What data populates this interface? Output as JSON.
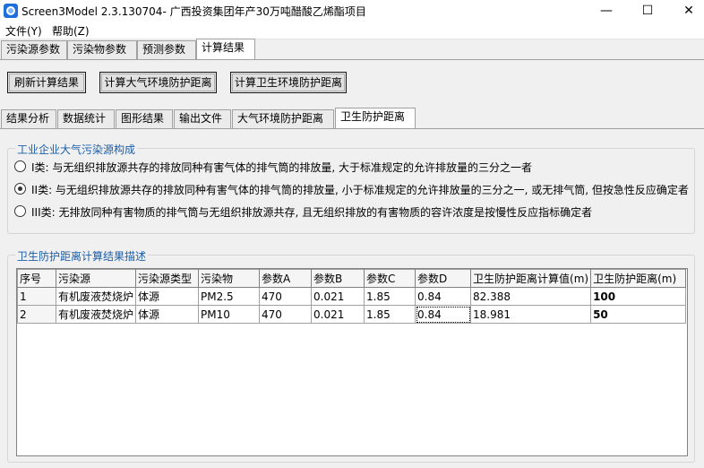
{
  "window": {
    "title": "Screen3Model 2.3.130704- 广西投资集团年产30万吨醋酸乙烯酯项目",
    "min": "—",
    "max": "☐",
    "close": "✕"
  },
  "menu": {
    "items": [
      "文件(Y)",
      "帮助(Z)"
    ]
  },
  "main_tabs": [
    "污染源参数",
    "污染物参数",
    "预测参数",
    "计算结果"
  ],
  "buttons": {
    "refresh": "刷新计算结果",
    "calc_atmos": "计算大气环境防护距离",
    "calc_health": "计算卫生环境防护距离"
  },
  "sub_tabs": [
    "结果分析",
    "数据统计",
    "图形结果",
    "输出文件",
    "大气环境防护距离",
    "卫生防护距离"
  ],
  "composition": {
    "title": "工业企业大气污染源构成",
    "options": [
      {
        "label": "I类: 与无组织排放源共存的排放同种有害气体的排气筒的排放量, 大于标准规定的允许排放量的三分之一者",
        "checked": false
      },
      {
        "label": "II类: 与无组织排放源共存的排放同种有害气体的排气筒的排放量, 小于标准规定的允许排放量的三分之一, 或无排气筒, 但按急性反应确定者",
        "checked": true
      },
      {
        "label": "III类: 无排放同种有害物质的排气筒与无组织排放源共存, 且无组织排放的有害物质的容许浓度是按慢性反应指标确定者",
        "checked": false
      }
    ]
  },
  "results": {
    "title": "卫生防护距离计算结果描述",
    "columns": [
      "序号",
      "污染源",
      "污染源类型",
      "污染物",
      "参数A",
      "参数B",
      "参数C",
      "参数D",
      "卫生防护距离计算值(m)",
      "卫生防护距离(m)"
    ],
    "rows": [
      [
        "1",
        "有机废液焚烧炉",
        "体源",
        "PM2.5",
        "470",
        "0.021",
        "1.85",
        "0.84",
        "82.388",
        "100"
      ],
      [
        "2",
        "有机废液焚烧炉",
        "体源",
        "PM10",
        "470",
        "0.021",
        "1.85",
        "0.84",
        "18.981",
        "50"
      ]
    ]
  }
}
